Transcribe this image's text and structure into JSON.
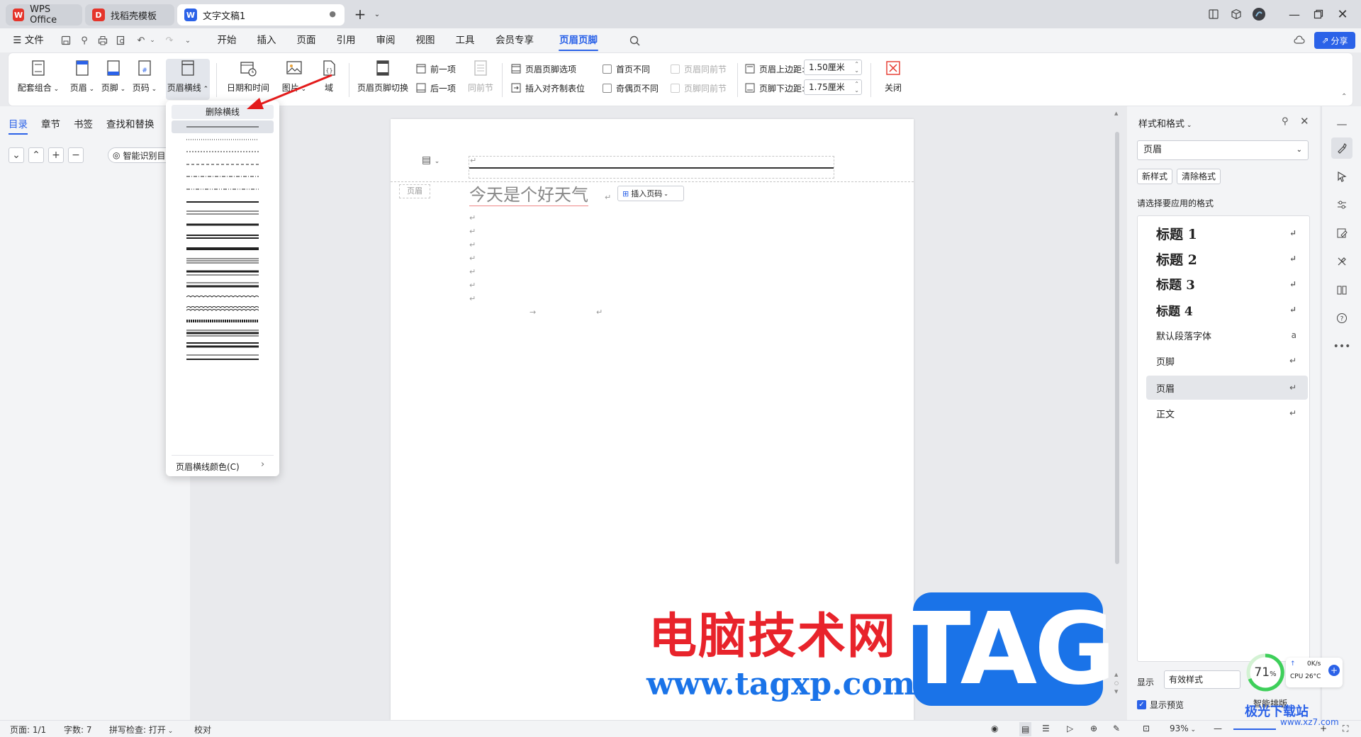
{
  "tabs": [
    {
      "label": "WPS Office"
    },
    {
      "label": "找稻壳模板"
    },
    {
      "label": "文字文稿1"
    }
  ],
  "menubar": {
    "file": "文件",
    "items": [
      "开始",
      "插入",
      "页面",
      "引用",
      "审阅",
      "视图",
      "工具",
      "会员专享",
      "页眉页脚"
    ],
    "active": "页眉页脚",
    "share": "分享"
  },
  "ribbon": {
    "combo": "配套组合",
    "header": "页眉",
    "footer": "页脚",
    "pagenum": "页码",
    "headerline": "页眉横线",
    "datetime": "日期和时间",
    "image": "图片",
    "field": "域",
    "switch": "页眉页脚切换",
    "prev": "前一项",
    "next": "后一项",
    "same_prev": "同前节",
    "options": "页眉页脚选项",
    "align_tab": "插入对齐制表位",
    "first_diff": "首页不同",
    "odd_even": "奇偶页不同",
    "header_same": "页眉同前节",
    "footer_same": "页脚同前节",
    "top_margin_label": "页眉上边距:",
    "top_margin": "1.50厘米",
    "bottom_margin_label": "页脚下边距:",
    "bottom_margin": "1.75厘米",
    "close": "关闭"
  },
  "left_panel": {
    "tabs": [
      "目录",
      "章节",
      "书签",
      "查找和替换"
    ],
    "active": "目录",
    "smart": "智能识别目"
  },
  "document": {
    "header_tag": "页眉",
    "body_text": "今天是个好天气",
    "insert_pagenum": "插入页码"
  },
  "dropdown": {
    "delete": "删除横线",
    "color": "页眉横线颜色(C)"
  },
  "right_panel": {
    "title": "样式和格式",
    "current": "页眉",
    "new_style": "新样式",
    "clear_format": "清除格式",
    "prompt": "请选择要应用的格式",
    "styles": [
      {
        "label": "标题  1",
        "mark": "↵"
      },
      {
        "label": "标题  2",
        "mark": "↵"
      },
      {
        "label": "标题  3",
        "mark": "↵"
      },
      {
        "label": "标题  4",
        "mark": "↵"
      },
      {
        "label": "默认段落字体",
        "mark": "a"
      },
      {
        "label": "页脚",
        "mark": "↵"
      },
      {
        "label": "页眉",
        "mark": "↵"
      },
      {
        "label": "正文",
        "mark": "↵"
      }
    ],
    "selected": "页眉",
    "display_label": "显示",
    "display_value": "有效样式",
    "preview": "显示预览",
    "smart_layout": "智能排版"
  },
  "widget": {
    "percent": "71",
    "unit": "%",
    "speed": "0K/s",
    "cpu": "CPU 26°C"
  },
  "watermark": {
    "cn": "电脑技术网",
    "url": "www.tagxp.com",
    "tag": "TAG",
    "site": "极光下载站",
    "site_url": "www.xz7.com"
  },
  "statusbar": {
    "page": "页面: 1/1",
    "words": "字数: 7",
    "spell": "拼写检查: 打开",
    "proof": "校对",
    "zoom": "93%"
  },
  "colors": {
    "accent": "#2b62e8",
    "wps_red": "#e5352b",
    "tag_blue": "#1a73e8",
    "wm_red": "#e8232b"
  }
}
